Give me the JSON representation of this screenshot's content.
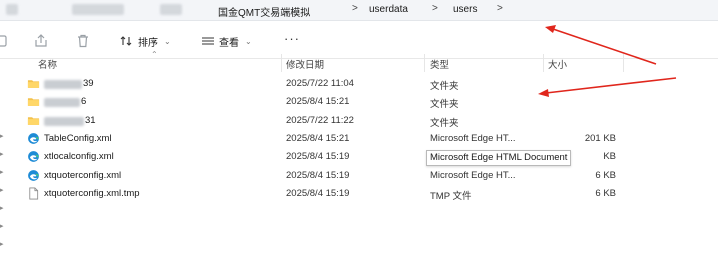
{
  "address": {
    "segments": [
      "国金QMT交易端模拟",
      "userdata",
      "users"
    ],
    "separator": ">"
  },
  "toolbar": {
    "sort_label": "排序",
    "view_label": "查看",
    "more_label": "···"
  },
  "columns": {
    "name": "名称",
    "modified": "修改日期",
    "type": "类型",
    "size": "大小"
  },
  "files": [
    {
      "icon": "folder-icon",
      "name": "39",
      "modified": "2025/7/22 11:04",
      "type": "文件夹",
      "size": ""
    },
    {
      "icon": "folder-icon",
      "name": "6",
      "modified": "2025/8/4 15:21",
      "type": "文件夹",
      "size": ""
    },
    {
      "icon": "folder-icon",
      "name": "31",
      "modified": "2025/7/22 11:22",
      "type": "文件夹",
      "size": ""
    },
    {
      "icon": "edge-icon",
      "name": "TableConfig.xml",
      "modified": "2025/8/4 15:21",
      "type": "Microsoft Edge HT...",
      "size": "201 KB"
    },
    {
      "icon": "edge-icon",
      "name": "xtlocalconfig.xml",
      "modified": "2025/8/4 15:19",
      "type": "Microsoft Edge HT...",
      "size": "KB"
    },
    {
      "icon": "edge-icon",
      "name": "xtquoterconfig.xml",
      "modified": "2025/8/4 15:19",
      "type": "Microsoft Edge HT...",
      "size": "6 KB"
    },
    {
      "icon": "document-icon",
      "name": "xtquoterconfig.xml.tmp",
      "modified": "2025/8/4 15:19",
      "type": "TMP 文件",
      "size": "6 KB"
    }
  ],
  "tooltip": {
    "text": "Microsoft Edge HTML Document"
  },
  "colors": {
    "annotation_arrow": "#e0261c",
    "folder": "#f4c24d",
    "edge": "#1e8bd6"
  }
}
